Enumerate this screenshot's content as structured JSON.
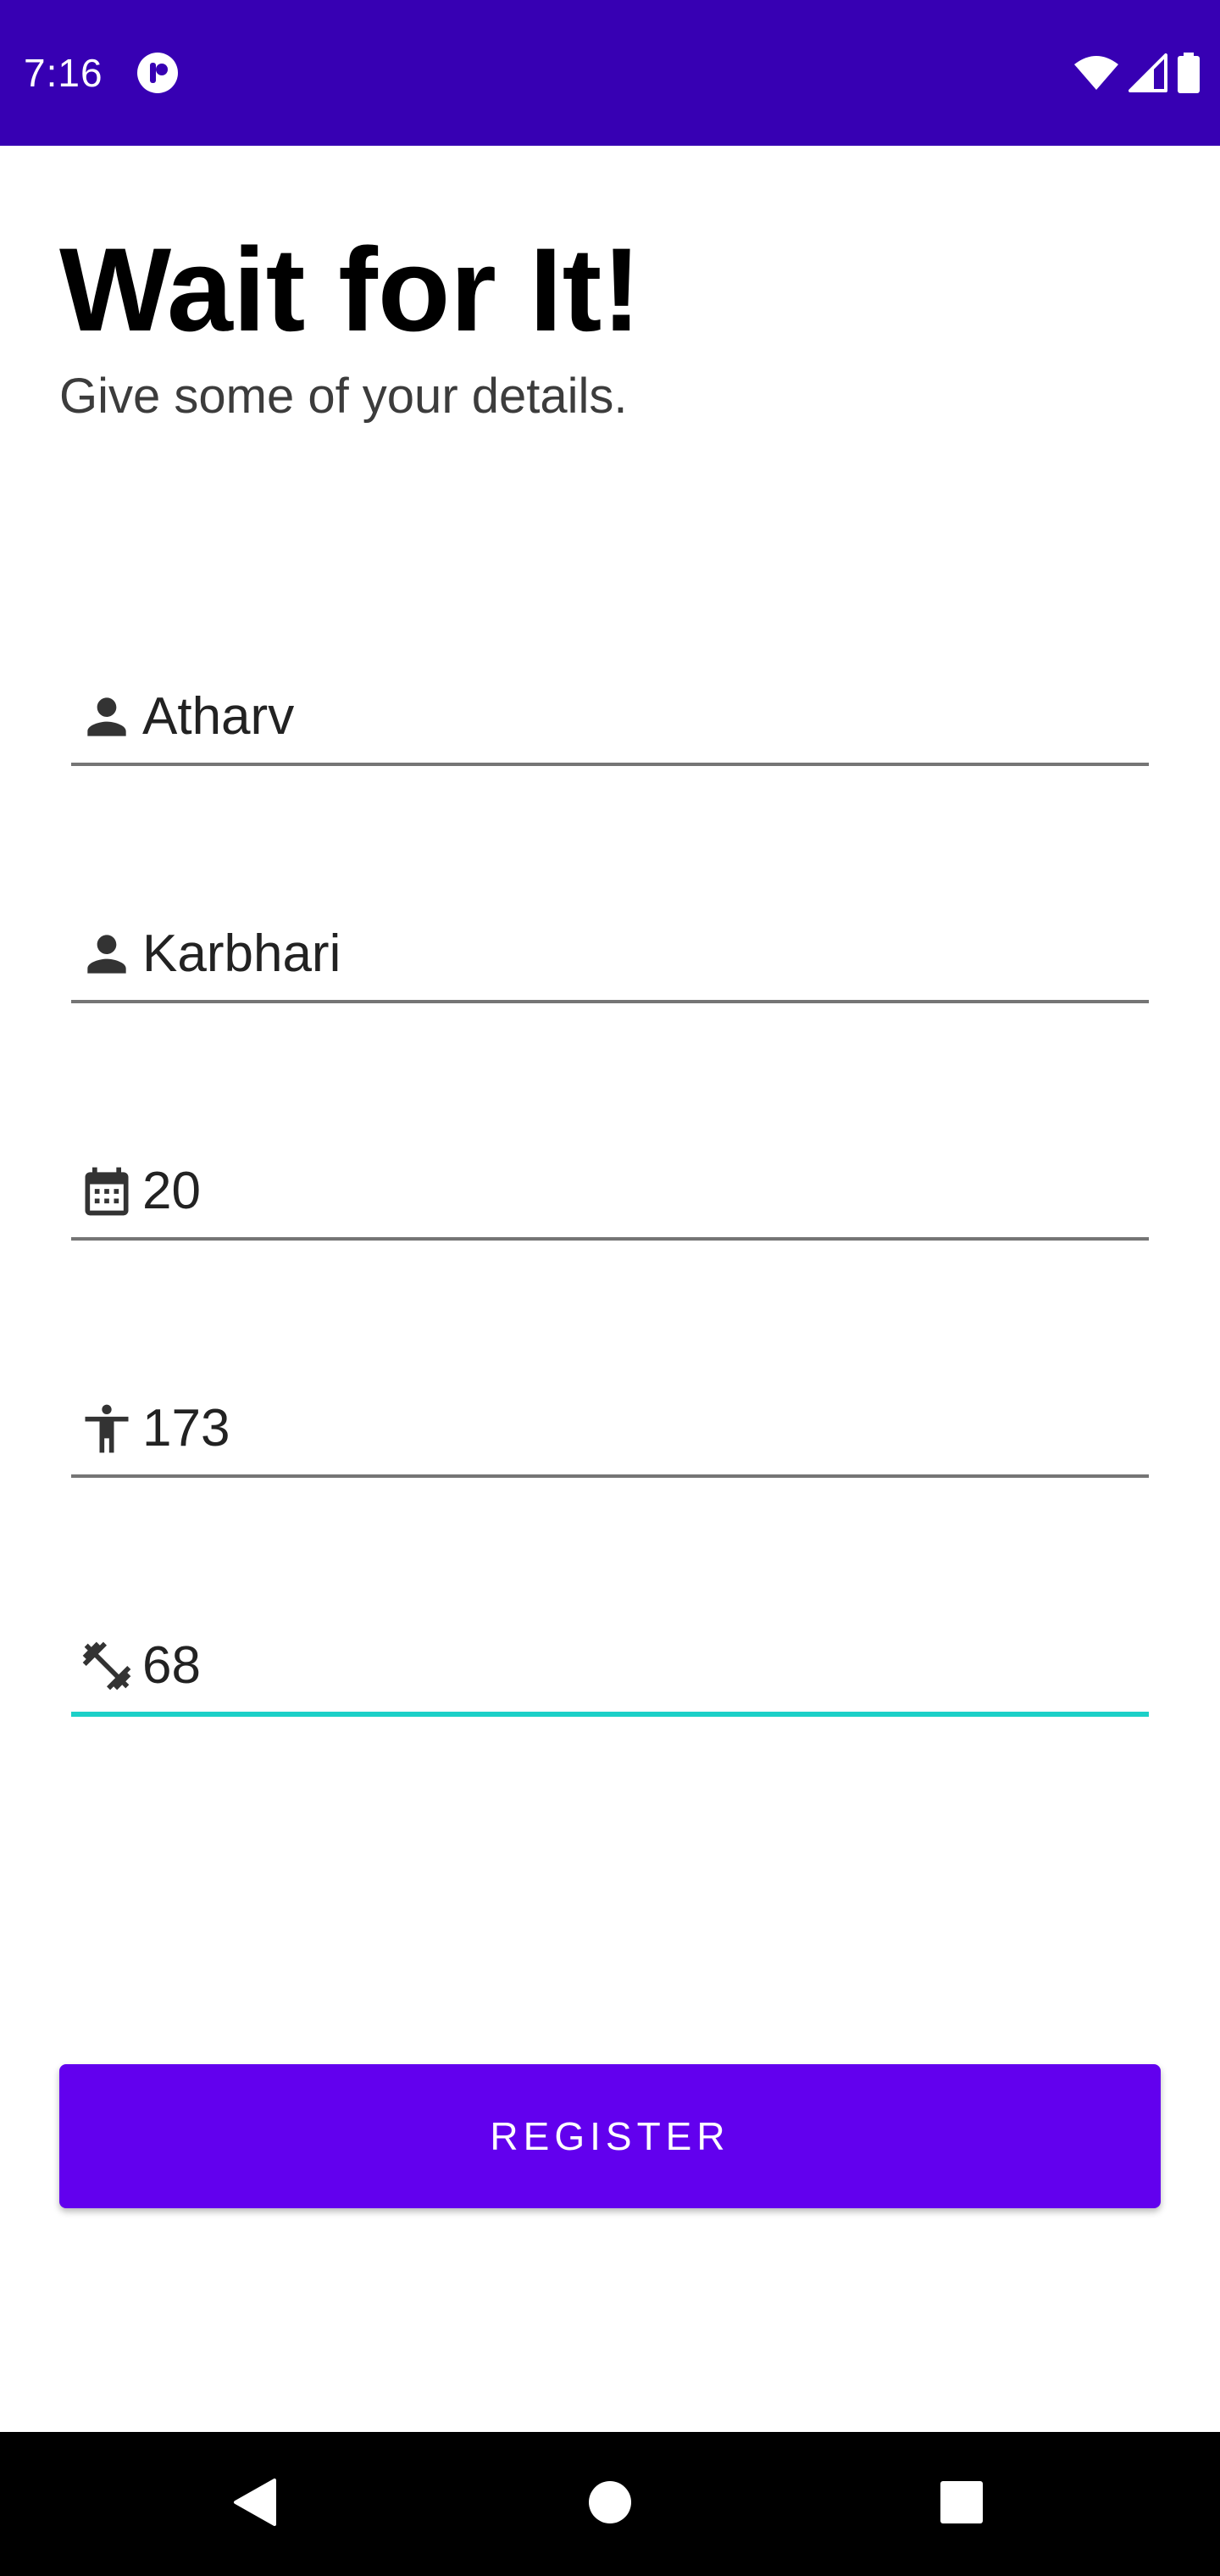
{
  "status_bar": {
    "time": "7:16",
    "background_color": "#3700b3",
    "icons": [
      "app-notification-icon",
      "wifi-icon",
      "cell-signal-icon",
      "battery-icon"
    ]
  },
  "header": {
    "title": "Wait for It!",
    "subtitle": "Give some of your details."
  },
  "form": {
    "fields": [
      {
        "name": "first-name-field",
        "icon": "person-icon",
        "value": "Atharv"
      },
      {
        "name": "last-name-field",
        "icon": "person-icon",
        "value": "Karbhari"
      },
      {
        "name": "age-field",
        "icon": "calendar-icon",
        "value": "20"
      },
      {
        "name": "height-field",
        "icon": "accessibility-icon",
        "value": "173"
      },
      {
        "name": "weight-field",
        "icon": "fitness-dumbbell-icon",
        "value": "68",
        "focused": true
      }
    ],
    "focus_color": "#1cd0c8"
  },
  "register_button": {
    "label": "REGISTER",
    "color": "#6200ee"
  },
  "nav_bar": {
    "icons": [
      "back-icon",
      "home-icon",
      "recents-icon"
    ]
  }
}
